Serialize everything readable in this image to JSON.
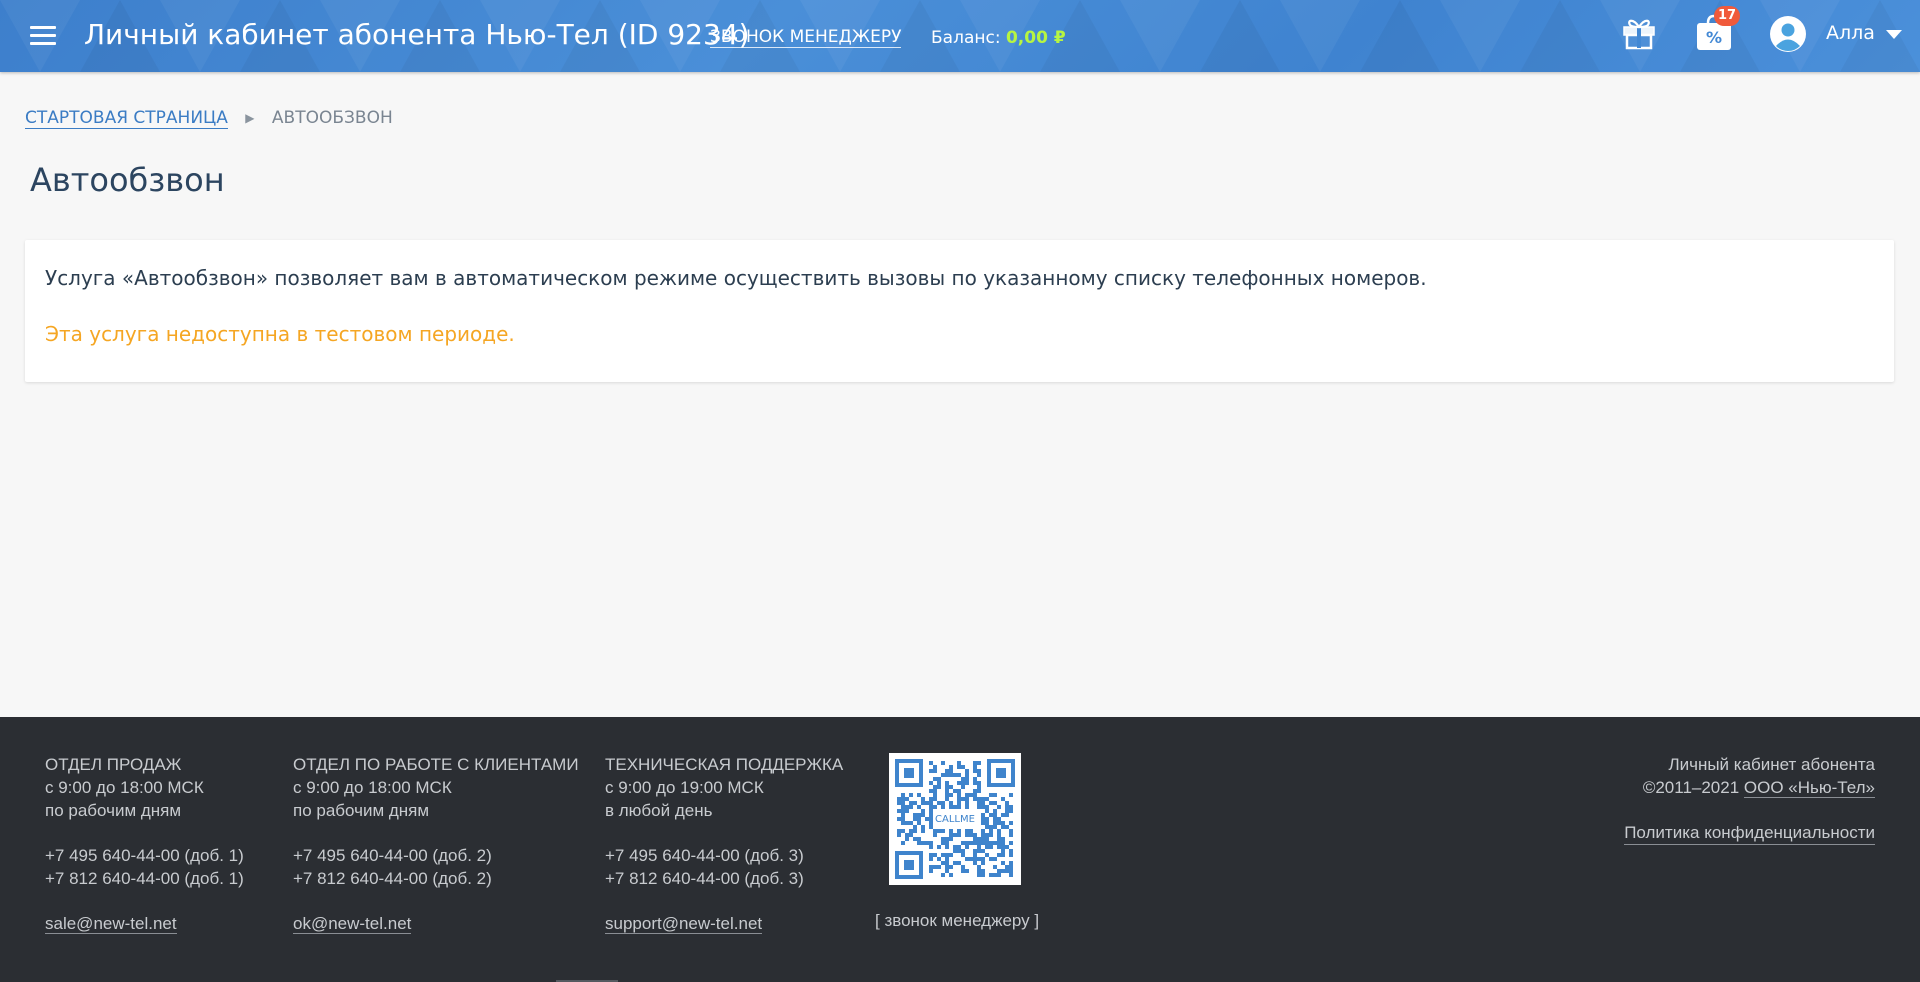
{
  "header": {
    "title": "Личный кабинет абонента Нью-Тел (ID 9234)",
    "call_manager": "ЗВОНОК МЕНЕДЖЕРУ",
    "balance_label": "Баланс:",
    "balance_value": "0,00 ₽",
    "promo_badge": "17",
    "promo_icon_text": "%",
    "user_name": "Алла",
    "icons": [
      "menu-icon",
      "gift-icon",
      "promo-icon",
      "user-avatar-icon",
      "caret-down-icon"
    ],
    "colors": {
      "bar": "#4288d4",
      "balance": "#b7f542",
      "badge": "#f05a3b"
    }
  },
  "breadcrumb": {
    "home": "СТАРТОВАЯ СТРАНИЦА",
    "current": "АВТООБЗВОН"
  },
  "page": {
    "title": "Автообзвон",
    "description": "Услуга «Автообзвон» позволяет вам в автоматическом режиме осуществить вызовы по указанному списку телефонных номеров.",
    "warning": "Эта услуга недоступна в тестовом периоде.",
    "colors": {
      "warning": "#f5a623"
    }
  },
  "footer": {
    "columns": [
      {
        "title": "ОТДЕЛ ПРОДАЖ",
        "hours": "с 9:00 до 18:00 МСК",
        "days": "по рабочим дням",
        "phone1": "+7 495 640-44-00  (доб. 1)",
        "phone2": "+7 812 640-44-00  (доб. 1)",
        "email": "sale@new-tel.net"
      },
      {
        "title": "ОТДЕЛ ПО РАБОТЕ С КЛИЕНТАМИ",
        "hours": "с 9:00 до 18:00 МСК",
        "days": "по рабочим дням",
        "phone1": "+7 495 640-44-00  (доб. 2)",
        "phone2": "+7 812 640-44-00  (доб. 2)",
        "email": "ok@new-tel.net"
      },
      {
        "title": "ТЕХНИЧЕСКАЯ ПОДДЕРЖКА",
        "hours": "с 9:00 до 19:00 МСК",
        "days": "в любой день",
        "phone1": "+7 495 640-44-00  (доб. 3)",
        "phone2": "+7 812 640-44-00  (доб. 3)",
        "email": "support@new-tel.net"
      }
    ],
    "qr_caption": "CALLME",
    "qr_link": "[ звонок менеджеру ]",
    "right_line1": "Личный кабинет абонента",
    "right_copyright": "©2011–2021",
    "right_company": "ООО «Нью-Тел»",
    "privacy": "Политика конфиденциальности"
  }
}
